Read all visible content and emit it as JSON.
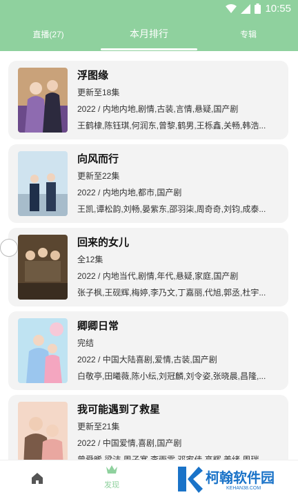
{
  "status_bar": {
    "time": "10:55",
    "icons": [
      "wifi-icon",
      "signal-icon",
      "battery-icon"
    ]
  },
  "tabs": [
    {
      "label": "直播(27)",
      "active": false
    },
    {
      "label": "本月排行",
      "active": true
    },
    {
      "label": "专辑",
      "active": false
    }
  ],
  "items": [
    {
      "title": "浮图缘",
      "status": "更新至18集",
      "meta": "2022 / 内地内地,剧情,古装,言情,悬疑,国产剧",
      "cast": "王鹤棣,陈钰琪,何润东,曾黎,鹤男,王栎鑫,关畅,韩浩..."
    },
    {
      "title": "向风而行",
      "status": "更新至22集",
      "meta": "2022 / 内地内地,都市,国产剧",
      "cast": "王凯,谭松韵,刘畅,晏紫东,邵羽柒,周奇奇,刘钧,成泰..."
    },
    {
      "title": "回来的女儿",
      "status": "全12集",
      "meta": "2022 / 内地当代,剧情,年代,悬疑,家庭,国产剧",
      "cast": "张子枫,王砚辉,梅婷,李乃文,丁嘉丽,代旭,郭丞,杜宇..."
    },
    {
      "title": "卿卿日常",
      "status": "完结",
      "meta": "2022 / 中国大陆喜剧,爱情,古装,国产剧",
      "cast": "白敬亭,田曦薇,陈小纭,刘冠麟,刘令姿,张晓晨,昌隆,..."
    },
    {
      "title": "我可能遇到了救星",
      "status": "更新至21集",
      "meta": "2022 / 中国爱情,喜剧,国产剧",
      "cast": "曾舜晞,梁洁,周子寒,李雨霏,邓家佳,高辉,姜绪,周瑞"
    }
  ],
  "bottom_nav": {
    "discover_label": "发现"
  },
  "watermark": {
    "text": "柯翰软件园",
    "url": "KEHAN38.COM"
  },
  "colors": {
    "primary": "#8fd19e",
    "card_bg": "#f3f3f3",
    "watermark_blue": "#1a73c8"
  }
}
